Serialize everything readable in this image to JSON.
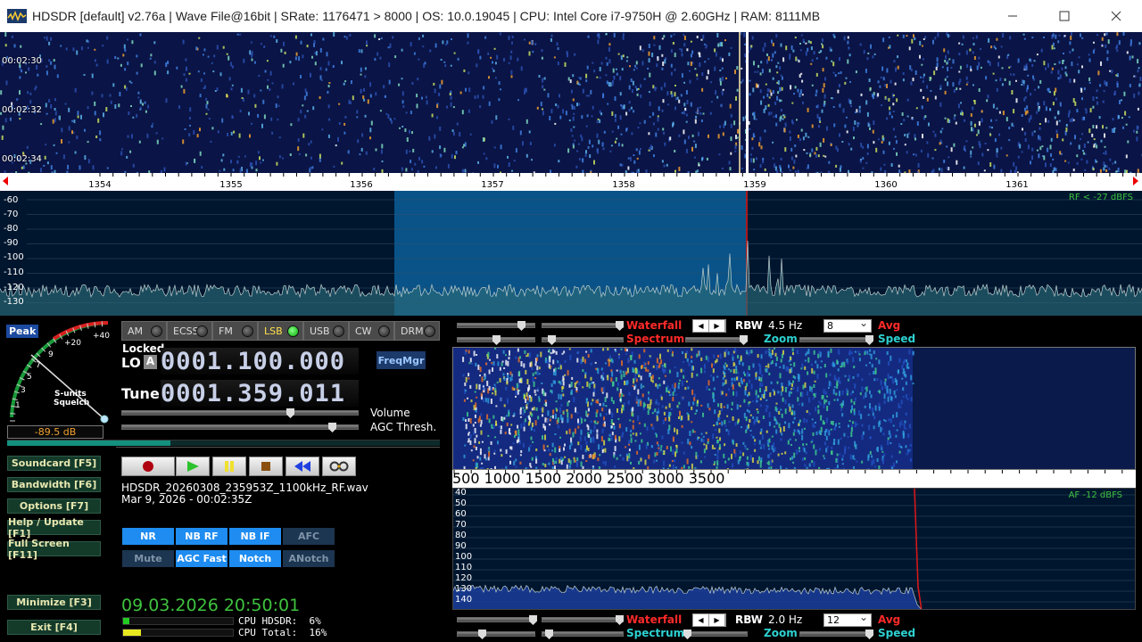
{
  "window": {
    "title": "HDSDR  [default]  v2.76a  |  Wave File@16bit  |  SRate: 1176471 > 8000  |  OS: 10.0.19045   |  CPU: Intel Core i7-9750H @ 2.60GHz  |  RAM: 8111MB",
    "minimize_icon": "minimize-icon",
    "maximize_icon": "maximize-icon",
    "close_icon": "close-icon"
  },
  "waterfall_times": [
    "00:02:30",
    "00:02:32",
    "00:02:34"
  ],
  "freq_scale": [
    "1354",
    "1355",
    "1356",
    "1357",
    "1358",
    "1359",
    "1360",
    "1361"
  ],
  "spectrum": {
    "db_labels": [
      "-60",
      "-70",
      "-80",
      "-90",
      "-100",
      "-110",
      "-120",
      "-130"
    ],
    "rf_level": "RF < -27 dBFS"
  },
  "smeter": {
    "peak_label": "Peak",
    "scale": [
      "1",
      "3",
      "5",
      "7",
      "9",
      "+20",
      "+40"
    ],
    "label1": "S-units",
    "label2": "Squelch",
    "reading": "-89.5 dB"
  },
  "modes": [
    {
      "label": "AM",
      "active": false
    },
    {
      "label": "ECSS",
      "active": false
    },
    {
      "label": "FM",
      "active": false
    },
    {
      "label": "LSB",
      "active": true
    },
    {
      "label": "USB",
      "active": false
    },
    {
      "label": "CW",
      "active": false
    },
    {
      "label": "DRM",
      "active": false
    }
  ],
  "lo": {
    "locked": "Locked",
    "label": "LO",
    "a_btn": "A",
    "freq": "0001.100.000",
    "freqmgr": "FreqMgr"
  },
  "tune": {
    "label": "Tune",
    "freq": "0001.359.011"
  },
  "sliders": {
    "volume": "Volume",
    "agc": "AGC Thresh."
  },
  "side_buttons": [
    "Soundcard  [F5]",
    "Bandwidth  [F6]",
    "Options     [F7]",
    "Help / Update  [F1]",
    "Full Screen  [F11]",
    "Minimize  [F3]",
    "Exit       [F4]"
  ],
  "transport": [
    "record-icon",
    "play-icon",
    "pause-icon",
    "stop-icon",
    "rewind-icon",
    "loop-icon"
  ],
  "file": {
    "name": "HDSDR_20260308_235953Z_1100kHz_RF.wav",
    "date": "Mar 9, 2026 - 00:02:35Z"
  },
  "dsp_row1": [
    {
      "label": "NR",
      "on": true
    },
    {
      "label": "NB RF",
      "on": true
    },
    {
      "label": "NB IF",
      "on": true
    },
    {
      "label": "AFC",
      "on": false
    }
  ],
  "dsp_row2": [
    {
      "label": "Mute",
      "on": false
    },
    {
      "label": "AGC Fast",
      "on": true
    },
    {
      "label": "Notch",
      "on": true
    },
    {
      "label": "ANotch",
      "on": false
    }
  ],
  "clock": "09.03.2026 20:50:01",
  "cpu": {
    "hdsdr": "CPU HDSDR:  6%",
    "total": "CPU Total:  16%",
    "hdsdr_pct": 6,
    "total_pct": 16
  },
  "rf_ctl": {
    "waterfall": "Waterfall",
    "spectrum": "Spectrum",
    "rbw_label": "RBW",
    "rbw_value": "4.5 Hz",
    "avg_select": "8",
    "avg": "Avg",
    "zoom": "Zoom",
    "speed": "Speed"
  },
  "af_ctl": {
    "waterfall": "Waterfall",
    "spectrum": "Spectrum",
    "rbw_label": "RBW",
    "rbw_value": "2.0 Hz",
    "avg_select": "12",
    "avg": "Avg",
    "zoom": "Zoom",
    "speed": "Speed"
  },
  "af_scale": [
    "500",
    "1000",
    "1500",
    "2000",
    "2500",
    "3000",
    "3500"
  ],
  "af_spectrum": {
    "db_labels": [
      "40",
      "50",
      "60",
      "70",
      "80",
      "90",
      "100",
      "110",
      "120",
      "130",
      "140"
    ],
    "af_level": "AF -12 dBFS"
  },
  "colors": {
    "accent_blue": "#1e8cf0",
    "panel_green": "#143a2a",
    "clock_green": "#3ec23e",
    "lsb_yellow": "#ffe04b",
    "red_label": "#ff2a2a",
    "cyan_label": "#2ed1d1"
  }
}
